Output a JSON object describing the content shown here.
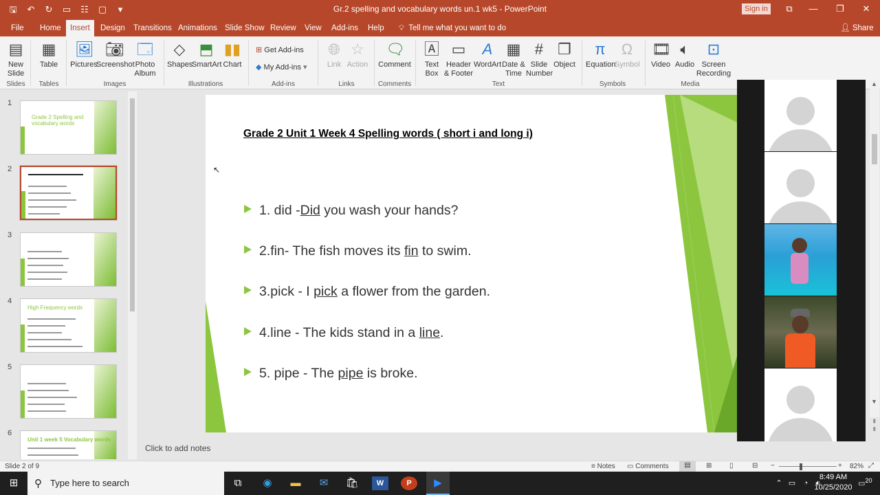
{
  "window": {
    "title": "Gr.2 spelling and vocabulary words un.1 wk5  -  PowerPoint",
    "signin": "Sign in"
  },
  "menu": {
    "tabs": [
      "File",
      "Home",
      "Insert",
      "Design",
      "Transitions",
      "Animations",
      "Slide Show",
      "Review",
      "View",
      "Add-ins",
      "Help"
    ],
    "active": "Insert",
    "tell_me": "Tell me what you want to do",
    "share": "Share"
  },
  "ribbon": {
    "new_slide": "New Slide",
    "table": "Table",
    "pictures": "Pictures",
    "screenshot": "Screenshot",
    "photo_album": "Photo Album",
    "shapes": "Shapes",
    "smartart": "SmartArt",
    "chart": "Chart",
    "get_addins": "Get Add-ins",
    "my_addins": "My Add-ins",
    "link": "Link",
    "action": "Action",
    "comment": "Comment",
    "text_box": "Text Box",
    "header_footer": "Header & Footer",
    "wordart": "WordArt",
    "date_time": "Date & Time",
    "slide_number": "Slide Number",
    "object": "Object",
    "equation": "Equation",
    "symbol": "Symbol",
    "video": "Video",
    "audio": "Audio",
    "screen_recording": "Screen Recording",
    "groups": {
      "slides": "Slides",
      "tables": "Tables",
      "images": "Images",
      "illustrations": "Illustrations",
      "addins": "Add-ins",
      "links": "Links",
      "comments": "Comments",
      "text": "Text",
      "symbols": "Symbols",
      "media": "Media"
    }
  },
  "thumbnails": [
    {
      "num": "1",
      "title": "Grade 2 Spelling and vocabulary words"
    },
    {
      "num": "2",
      "title": ""
    },
    {
      "num": "3",
      "title": ""
    },
    {
      "num": "4",
      "title": "High Frequency words"
    },
    {
      "num": "5",
      "title": ""
    },
    {
      "num": "6",
      "title": "Unit 1 week 5 Vocabulary words"
    }
  ],
  "slide": {
    "title": "Grade 2 Unit 1 Week 4 Spelling words ( short i and long i)",
    "bullets": [
      {
        "pre": "1. did -",
        "u": "Did",
        "post": " you wash your hands?"
      },
      {
        "pre": "2.fin- The fish moves its ",
        "u": "fin",
        "post": " to swim."
      },
      {
        "pre": "3.pick - I ",
        "u": "pick",
        "post": " a flower from the garden."
      },
      {
        "pre": "4.line - The kids stand in a ",
        "u": "line",
        "post": "."
      },
      {
        "pre": "5. pipe - The ",
        "u": "pipe",
        "post": " is broke."
      }
    ]
  },
  "notes_placeholder": "Click to add notes",
  "status": {
    "slide": "Slide 2 of 9",
    "notes": "Notes",
    "comments": "Comments",
    "zoom": "82%"
  },
  "taskbar": {
    "search": "Type here to search",
    "time": "8:49 AM",
    "date": "10/25/2020",
    "notifications": "20"
  },
  "colors": {
    "accent": "#b7472a",
    "green": "#8cc63f"
  }
}
